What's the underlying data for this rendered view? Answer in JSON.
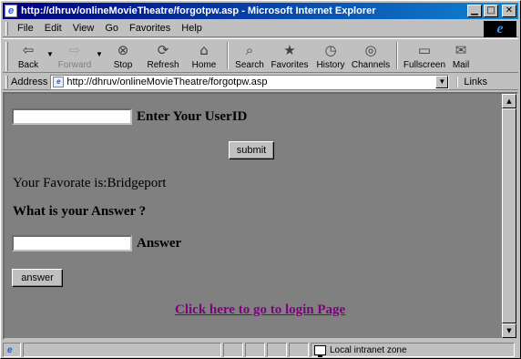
{
  "window": {
    "title": "http://dhruv/onlineMovieTheatre/forgotpw.asp - Microsoft Internet Explorer",
    "app_icon": "ie-logo-icon",
    "controls": [
      "minimize",
      "maximize",
      "close"
    ]
  },
  "menu": {
    "items": [
      "File",
      "Edit",
      "View",
      "Go",
      "Favorites",
      "Help"
    ]
  },
  "toolbar": {
    "buttons": [
      {
        "label": "Back",
        "icon": "back-arrow-icon",
        "enabled": true
      },
      {
        "label": "Forward",
        "icon": "forward-arrow-icon",
        "enabled": false
      },
      {
        "label": "Stop",
        "icon": "stop-icon",
        "enabled": true
      },
      {
        "label": "Refresh",
        "icon": "refresh-icon",
        "enabled": true
      },
      {
        "label": "Home",
        "icon": "home-icon",
        "enabled": true
      },
      {
        "label": "Search",
        "icon": "search-icon",
        "enabled": true
      },
      {
        "label": "Favorites",
        "icon": "favorites-icon",
        "enabled": true
      },
      {
        "label": "History",
        "icon": "history-icon",
        "enabled": true
      },
      {
        "label": "Channels",
        "icon": "channels-icon",
        "enabled": true
      },
      {
        "label": "Fullscreen",
        "icon": "fullscreen-icon",
        "enabled": true
      },
      {
        "label": "Mail",
        "icon": "mail-icon",
        "enabled": true
      }
    ]
  },
  "address": {
    "label": "Address",
    "url": "http://dhruv/onlineMovieTheatre/forgotpw.asp",
    "links_label": "Links"
  },
  "page": {
    "userid_label": "Enter Your UserID",
    "userid_value": "",
    "submit_label": "submit",
    "favorite_text": "Your Favorate is:Bridgeport",
    "question_text": "What is your Answer ?",
    "answer_label": "Answer",
    "answer_value": "",
    "answer_button": "answer",
    "login_link": "Click here to go to login Page",
    "link_color": "#800080",
    "background_color": "#808080"
  },
  "status": {
    "zone_text": "Local intranet zone"
  }
}
